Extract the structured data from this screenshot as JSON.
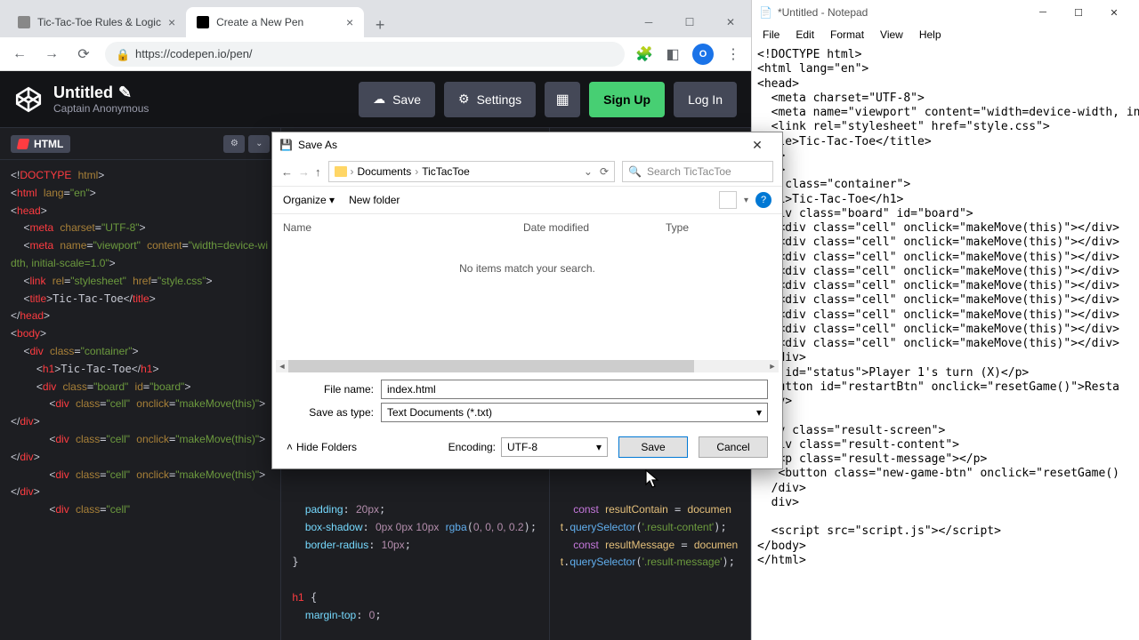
{
  "browser": {
    "tabs": [
      {
        "title": "Tic-Tac-Toe Rules & Logic"
      },
      {
        "title": "Create a New Pen"
      }
    ],
    "url": "https://codepen.io/pen/",
    "avatar_initial": "O"
  },
  "codepen": {
    "title": "Untitled",
    "author": "Captain Anonymous",
    "buttons": {
      "save": "Save",
      "settings": "Settings",
      "signup": "Sign Up",
      "login": "Log In"
    },
    "panels": {
      "html_label": "HTML",
      "html_code": "<!DOCTYPE html>\n<html lang=\"en\">\n<head>\n  <meta charset=\"UTF-8\">\n  <meta name=\"viewport\" content=\"width=device-width, initial-scale=1.0\">\n  <link rel=\"stylesheet\" href=\"style.css\">\n  <title>Tic-Tac-Toe</title>\n</head>\n<body>\n  <div class=\"container\">\n    <h1>Tic-Tac-Toe</h1>\n    <div class=\"board\" id=\"board\">\n      <div class=\"cell\" onclick=\"makeMove(this)\"></div>\n      <div class=\"cell\" onclick=\"makeMove(this)\"></div>\n      <div class=\"cell\" onclick=\"makeMove(this)\"></div>\n      <div class=\"cell\"",
      "css_code_tail": "  padding: 20px;\n  box-shadow: 0px 0px 10px rgba(0, 0, 0, 0.2);\n  border-radius: 10px;\n}\n\nh1 {\n  margin-top: 0;",
      "js_code_tail": "const resultContain = document.querySelector('.result-content');\nconst resultMessage = document.querySelector('.result-message');"
    }
  },
  "dialog": {
    "title": "Save As",
    "path": {
      "seg1": "Documents",
      "seg2": "TicTacToe"
    },
    "search_placeholder": "Search TicTacToe",
    "toolbar": {
      "organize": "Organize ▾",
      "newfolder": "New folder"
    },
    "columns": {
      "name": "Name",
      "date": "Date modified",
      "type": "Type"
    },
    "empty": "No items match your search.",
    "fields": {
      "filename_label": "File name:",
      "filename_value": "index.html",
      "savetype_label": "Save as type:",
      "savetype_value": "Text Documents (*.txt)"
    },
    "footer": {
      "hide_folders": "Hide Folders",
      "encoding_label": "Encoding:",
      "encoding_value": "UTF-8",
      "save": "Save",
      "cancel": "Cancel"
    }
  },
  "notepad": {
    "title": "*Untitled - Notepad",
    "menus": {
      "file": "File",
      "edit": "Edit",
      "format": "Format",
      "view": "View",
      "help": "Help"
    },
    "content": "<!DOCTYPE html>\n<html lang=\"en\">\n<head>\n  <meta charset=\"UTF-8\">\n  <meta name=\"viewport\" content=\"width=device-width, in\n  <link rel=\"stylesheet\" href=\"style.css\">\n  tle>Tic-Tac-Toe</title>\n  d>\n  y>\n  v class=\"container\">\n  h1>Tic-Tac-Toe</h1>\n  div class=\"board\" id=\"board\">\n   <div class=\"cell\" onclick=\"makeMove(this)\"></div>\n   <div class=\"cell\" onclick=\"makeMove(this)\"></div>\n   <div class=\"cell\" onclick=\"makeMove(this)\"></div>\n   <div class=\"cell\" onclick=\"makeMove(this)\"></div>\n   <div class=\"cell\" onclick=\"makeMove(this)\"></div>\n   <div class=\"cell\" onclick=\"makeMove(this)\"></div>\n   <div class=\"cell\" onclick=\"makeMove(this)\"></div>\n   <div class=\"cell\" onclick=\"makeMove(this)\"></div>\n   <div class=\"cell\" onclick=\"makeMove(this)\"></div>\n  /div>\n  p id=\"status\">Player 1's turn (X)</p>\n  button id=\"restartBtn\" onclick=\"resetGame()\">Resta\n  iv>\n\n  iv class=\"result-screen\">\n  div class=\"result-content\">\n   <p class=\"result-message\"></p>\n   <button class=\"new-game-btn\" onclick=\"resetGame()\n  /div>\n  div>\n\n  <script src=\"script.js\"></script>\n</body>\n</html>"
  }
}
